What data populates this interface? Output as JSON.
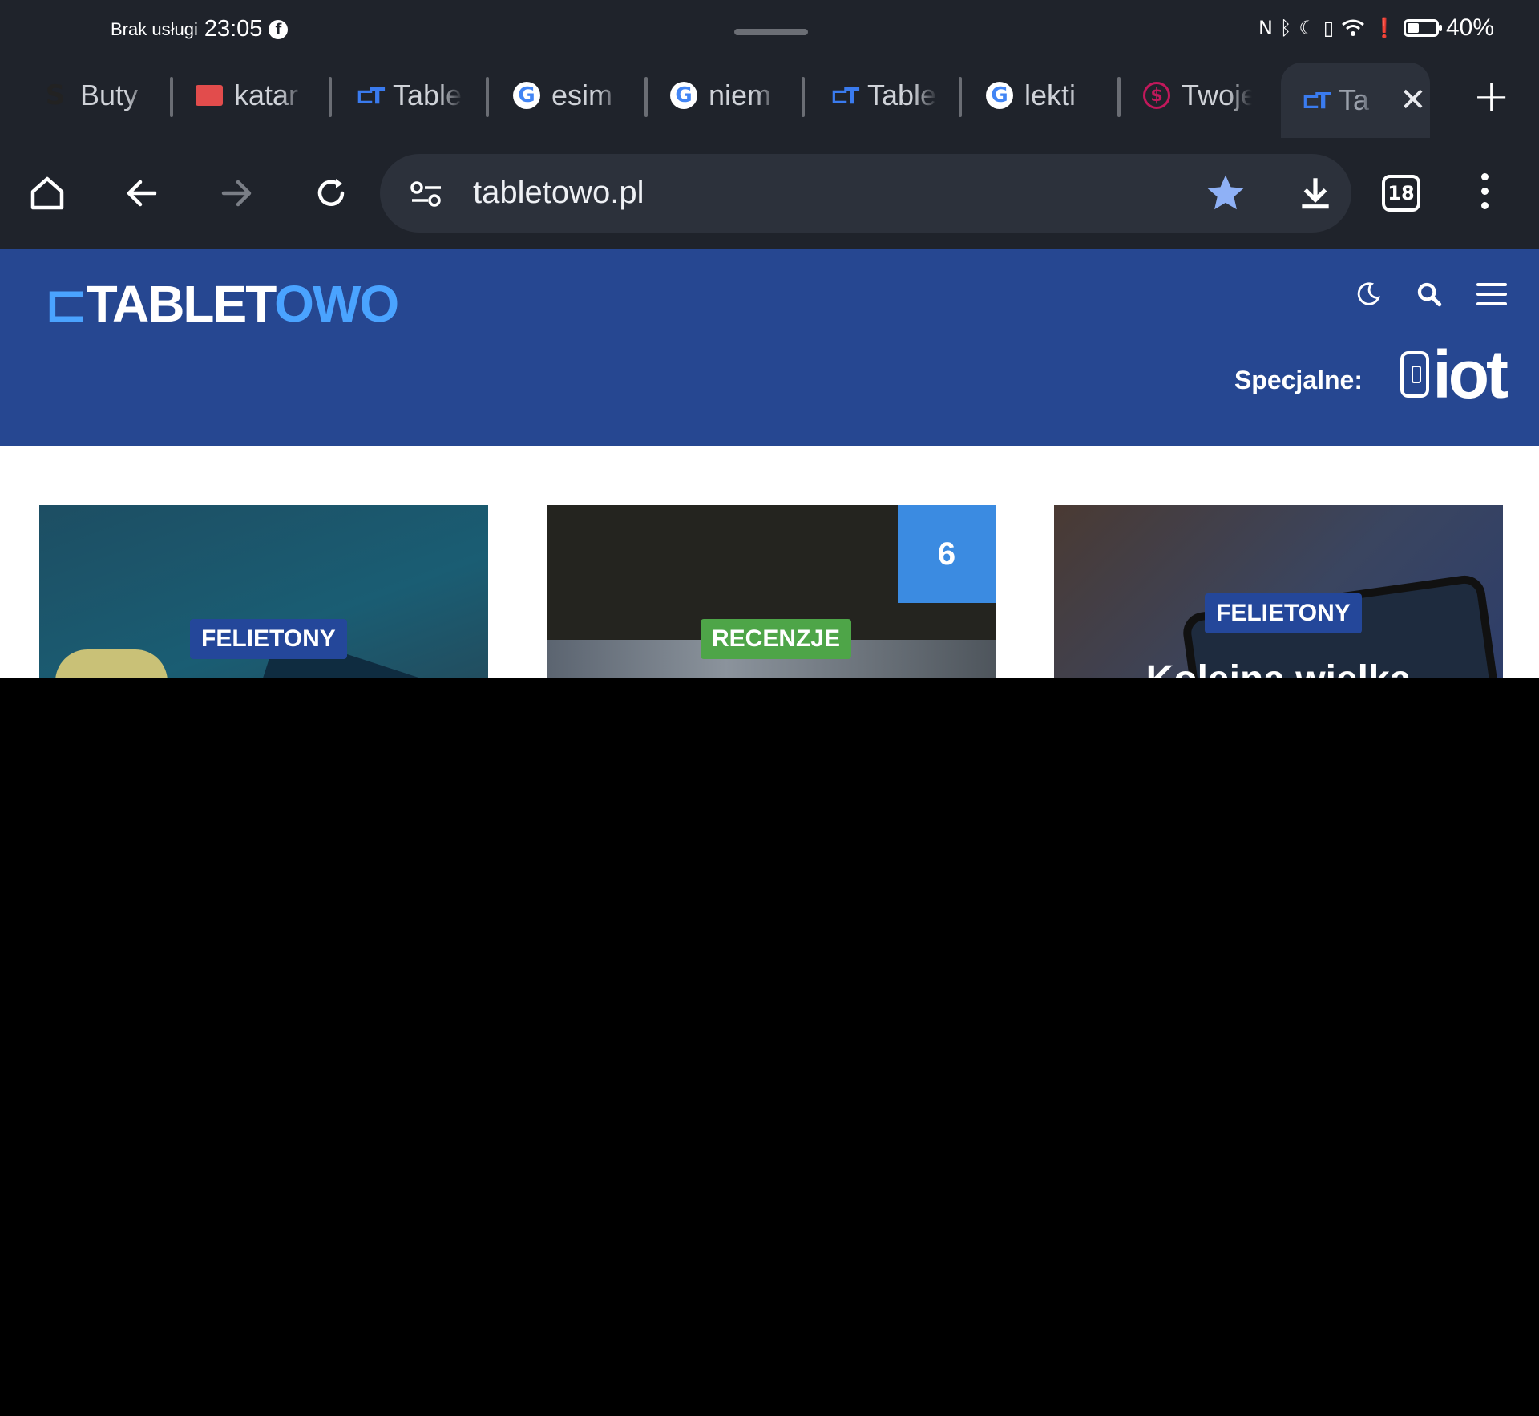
{
  "status_bar": {
    "carrier": "Brak usługi",
    "time": "23:05",
    "battery_percent": "40%",
    "battery_level": 0.4
  },
  "tabs": [
    {
      "title": "Buty",
      "favicon": "s-icon"
    },
    {
      "title": "katar",
      "favicon": "mail-icon"
    },
    {
      "title": "Table",
      "favicon": "tabletowo-icon"
    },
    {
      "title": "esim",
      "favicon": "google-icon"
    },
    {
      "title": "niem",
      "favicon": "google-icon"
    },
    {
      "title": "Table",
      "favicon": "tabletowo-icon"
    },
    {
      "title": "lekti",
      "favicon": "google-icon"
    },
    {
      "title": "Twoje",
      "favicon": "dollar-icon"
    },
    {
      "title": "Ta",
      "favicon": "tabletowo-icon",
      "active": true
    }
  ],
  "toolbar": {
    "url": "tabletowo.pl",
    "tab_count": "18"
  },
  "site": {
    "logo_text_a": "TABLET",
    "logo_text_b": "OWO",
    "special_label": "Specjalne:",
    "special_brand": "iot"
  },
  "cards": [
    {
      "category": "FELIETONY",
      "title": ""
    },
    {
      "category": "RECENZJE",
      "score": "6",
      "title": ""
    },
    {
      "category": "FELIETONY",
      "title": "Kolejna wielka"
    }
  ],
  "colors": {
    "chrome_bg": "#1f232b",
    "site_header": "#264791",
    "category_blue": "#24479a",
    "category_green": "#4ea548",
    "score_blue": "#3b8be1"
  }
}
